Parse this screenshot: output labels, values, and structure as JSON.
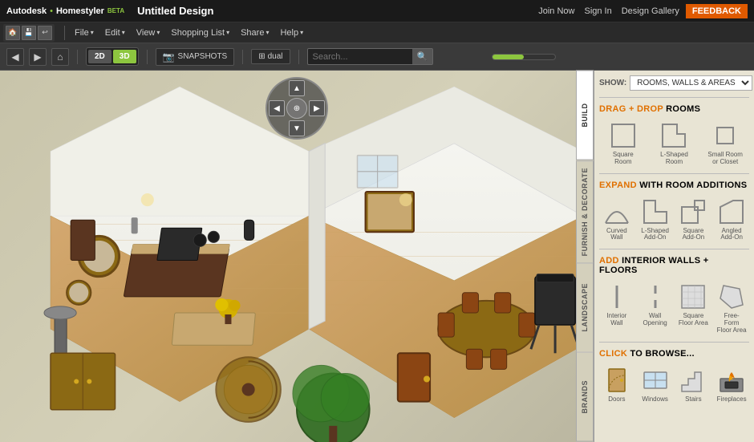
{
  "topbar": {
    "logo": "Autodesk",
    "logo_dot": "•",
    "logo_brand": "Homestyler",
    "logo_super": "BETA",
    "title": "Untitled Design",
    "links": [
      "Join Now",
      "Sign In",
      "Design Gallery"
    ],
    "feedback": "FEEDBACK"
  },
  "menubar": {
    "icons": [
      "🏠",
      "💾",
      "↩"
    ],
    "items": [
      "File",
      "Edit",
      "View",
      "Shopping List",
      "Share",
      "Help"
    ]
  },
  "toolbar": {
    "view_2d": "2D",
    "view_3d": "3D",
    "snapshot": "SNAPSHOTS",
    "dual": "dual",
    "search_placeholder": "Search...",
    "back": "◀",
    "forward": "▶",
    "home": "⌂"
  },
  "panel": {
    "show_label": "SHOW:",
    "show_value": "ROOMS, WALLS & AREAS",
    "sections": {
      "drag_drop": {
        "label_orange": "DRAG + DROP",
        "label_rest": " ROOMS",
        "items": [
          {
            "id": "square-room",
            "label": "Square\nRoom"
          },
          {
            "id": "l-shaped-room",
            "label": "L-Shaped\nRoom"
          },
          {
            "id": "small-room",
            "label": "Small Room\nor Closet"
          }
        ]
      },
      "expand": {
        "label_orange": "EXPAND",
        "label_rest": " WITH ROOM ADDITIONS",
        "items": [
          {
            "id": "curved-wall",
            "label": "Curved Wall"
          },
          {
            "id": "l-shaped-addon",
            "label": "L-Shaped\nAdd-On"
          },
          {
            "id": "square-addon",
            "label": "Square\nAdd-On"
          },
          {
            "id": "angled-addon",
            "label": "Angled\nAdd-On"
          }
        ]
      },
      "add_walls": {
        "label_orange": "ADD",
        "label_rest": " INTERIOR WALLS + FLOORS",
        "items": [
          {
            "id": "interior-wall",
            "label": "Interior\nWall"
          },
          {
            "id": "wall-opening",
            "label": "Wall\nOpening"
          },
          {
            "id": "square-floor",
            "label": "Square\nFloor Area"
          },
          {
            "id": "freeform-floor",
            "label": "Free-Form\nFloor Area"
          }
        ]
      },
      "browse": {
        "label_orange": "CLICK",
        "label_rest": " TO BROWSE...",
        "items": [
          {
            "id": "doors",
            "label": "Doors"
          },
          {
            "id": "windows",
            "label": "Windows"
          },
          {
            "id": "stairs",
            "label": "Stairs"
          },
          {
            "id": "fireplaces",
            "label": "Fireplaces"
          }
        ]
      }
    },
    "vert_tabs": [
      "BUILD",
      "FURNISH & DECORATE",
      "LANDSCAPE",
      "BRANDS"
    ]
  },
  "colors": {
    "orange": "#e07000",
    "green": "#8dc63f",
    "bg_main": "#c8c4aa",
    "bg_panel": "#e8e4d4",
    "topbar_bg": "#1a1a1a",
    "feedback": "#e05a00"
  }
}
